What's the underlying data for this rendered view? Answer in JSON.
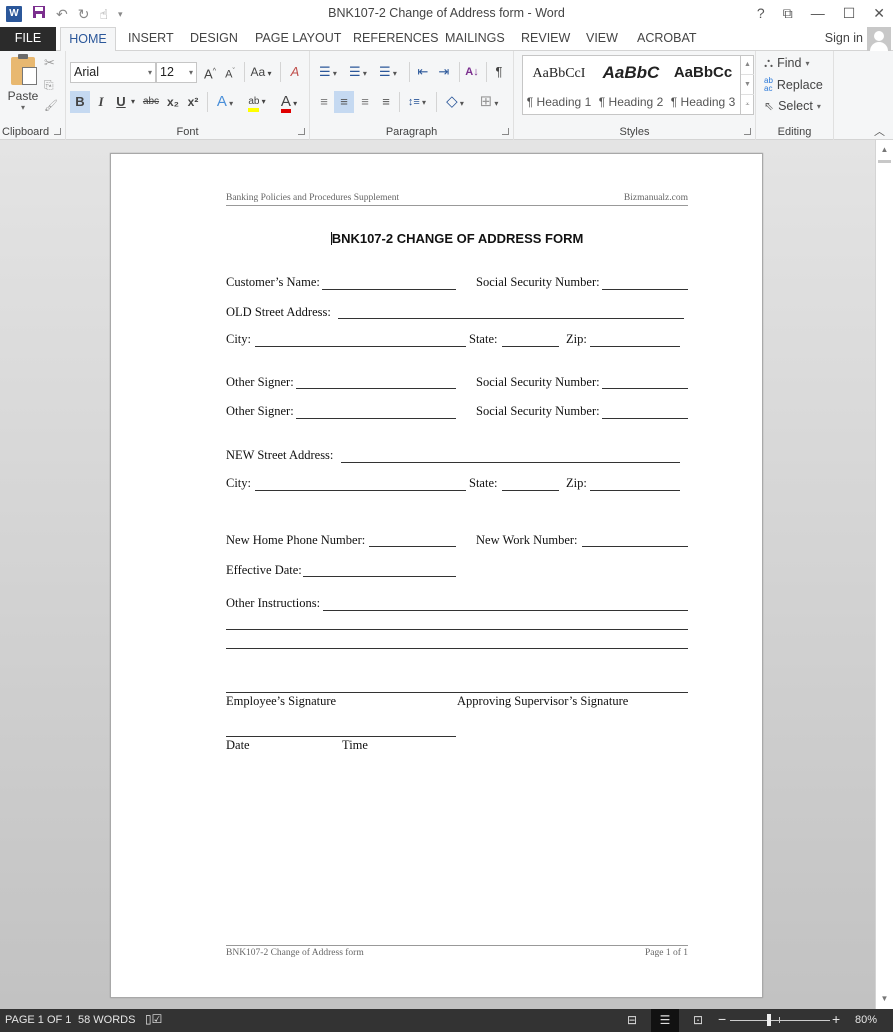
{
  "window": {
    "title": "BNK107-2 Change of Address form - Word",
    "controls": {
      "help": "?",
      "restore_ribbon": "⧉",
      "minimize": "—",
      "maximize": "☐",
      "close": "✕"
    }
  },
  "quick_access": {
    "app_icon": "W",
    "save_icon": "💾",
    "undo_icon": "↶",
    "redo_icon": "↻",
    "touch_icon": "☝",
    "customize_icon": "▾"
  },
  "tabs": [
    {
      "label": "FILE"
    },
    {
      "label": "HOME",
      "active": true
    },
    {
      "label": "INSERT"
    },
    {
      "label": "DESIGN"
    },
    {
      "label": "PAGE LAYOUT"
    },
    {
      "label": "REFERENCES"
    },
    {
      "label": "MAILINGS"
    },
    {
      "label": "REVIEW"
    },
    {
      "label": "VIEW"
    },
    {
      "label": "ACROBAT"
    }
  ],
  "account": {
    "sign_in": "Sign in"
  },
  "ribbon": {
    "clipboard": {
      "label": "Clipboard",
      "paste": "Paste",
      "cut_icon": "✂",
      "copy_icon": "⎘",
      "format_painter_icon": "🖌"
    },
    "font": {
      "label": "Font",
      "font_name": "Arial",
      "font_size": "12",
      "grow": "A",
      "shrink": "A",
      "change_case": "Aa",
      "clear_format": "A",
      "bold": "B",
      "italic": "I",
      "underline": "U",
      "strikethrough": "abc",
      "subscript": "x₂",
      "superscript": "x²",
      "text_effects": "A",
      "highlight": "ab",
      "font_color": "A",
      "highlight_color": "#ffff00",
      "font_color_value": "#e00000"
    },
    "paragraph": {
      "label": "Paragraph",
      "bullets": "☰",
      "numbering": "☰",
      "multilevel": "☰",
      "decrease_indent": "⇤",
      "increase_indent": "⇥",
      "sort": "A↓",
      "show_marks": "¶",
      "align_left": "≡",
      "align_center": "≡",
      "align_right": "≡",
      "justify": "≡",
      "line_spacing": "↕≡",
      "shading": "◇",
      "borders": "⊞"
    },
    "styles": {
      "label": "Styles",
      "items": [
        {
          "sample": "AaBbCcI",
          "name": "¶ Heading 1"
        },
        {
          "sample": "AaBbC",
          "name": "¶ Heading 2"
        },
        {
          "sample": "AaBbCc",
          "name": "¶ Heading 3"
        }
      ]
    },
    "editing": {
      "label": "Editing",
      "find": "Find",
      "replace": "Replace",
      "select": "Select"
    }
  },
  "document": {
    "header_left": "Banking Policies and Procedures Supplement",
    "header_right": "Bizmanualz.com",
    "title": "BNK107-2 CHANGE OF ADDRESS FORM",
    "fields": {
      "customer_name": "Customer’s Name:",
      "ssn1": "Social Security Number:",
      "old_street": "OLD Street Address:",
      "old_city": "City:",
      "old_state": "State:",
      "old_zip": "Zip:",
      "other_signer1": "Other Signer:",
      "ssn2": "Social Security Number:",
      "other_signer2": "Other Signer:",
      "ssn3": "Social Security Number:",
      "new_street": "NEW Street Address:",
      "new_city": "City:",
      "new_state": "State:",
      "new_zip": "Zip:",
      "home_phone": "New Home Phone Number:",
      "work_number": "New Work Number:",
      "effective_date": "Effective Date:",
      "other_instructions": "Other Instructions:",
      "employee_sig": "Employee’s Signature",
      "supervisor_sig": "Approving Supervisor’s Signature",
      "date": "Date",
      "time": "Time"
    },
    "footer_left": "BNK107-2 Change of Address form",
    "footer_right": "Page 1 of 1"
  },
  "statusbar": {
    "page": "PAGE 1 OF 1",
    "words": "58 WORDS",
    "proofing_icon": "📖",
    "read_mode_icon": "📖",
    "print_layout_icon": "▤",
    "web_layout_icon": "🌐",
    "zoom_out": "−",
    "zoom_in": "+",
    "zoom_level": "80%",
    "zoom_percent": 80
  }
}
